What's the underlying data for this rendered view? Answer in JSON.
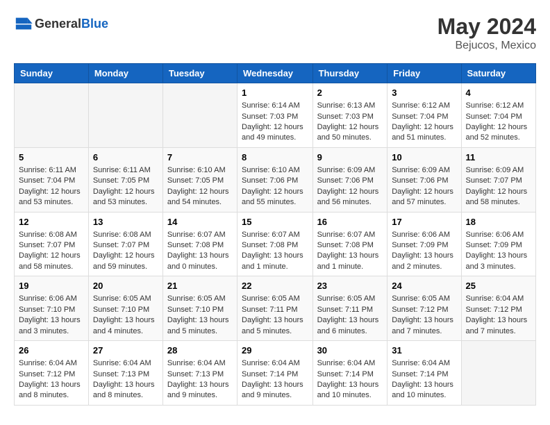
{
  "header": {
    "logo_general": "General",
    "logo_blue": "Blue",
    "month": "May 2024",
    "location": "Bejucos, Mexico"
  },
  "weekdays": [
    "Sunday",
    "Monday",
    "Tuesday",
    "Wednesday",
    "Thursday",
    "Friday",
    "Saturday"
  ],
  "weeks": [
    [
      {
        "day": "",
        "sunrise": "",
        "sunset": "",
        "daylight": ""
      },
      {
        "day": "",
        "sunrise": "",
        "sunset": "",
        "daylight": ""
      },
      {
        "day": "",
        "sunrise": "",
        "sunset": "",
        "daylight": ""
      },
      {
        "day": "1",
        "sunrise": "Sunrise: 6:14 AM",
        "sunset": "Sunset: 7:03 PM",
        "daylight": "Daylight: 12 hours and 49 minutes."
      },
      {
        "day": "2",
        "sunrise": "Sunrise: 6:13 AM",
        "sunset": "Sunset: 7:03 PM",
        "daylight": "Daylight: 12 hours and 50 minutes."
      },
      {
        "day": "3",
        "sunrise": "Sunrise: 6:12 AM",
        "sunset": "Sunset: 7:04 PM",
        "daylight": "Daylight: 12 hours and 51 minutes."
      },
      {
        "day": "4",
        "sunrise": "Sunrise: 6:12 AM",
        "sunset": "Sunset: 7:04 PM",
        "daylight": "Daylight: 12 hours and 52 minutes."
      }
    ],
    [
      {
        "day": "5",
        "sunrise": "Sunrise: 6:11 AM",
        "sunset": "Sunset: 7:04 PM",
        "daylight": "Daylight: 12 hours and 53 minutes."
      },
      {
        "day": "6",
        "sunrise": "Sunrise: 6:11 AM",
        "sunset": "Sunset: 7:05 PM",
        "daylight": "Daylight: 12 hours and 53 minutes."
      },
      {
        "day": "7",
        "sunrise": "Sunrise: 6:10 AM",
        "sunset": "Sunset: 7:05 PM",
        "daylight": "Daylight: 12 hours and 54 minutes."
      },
      {
        "day": "8",
        "sunrise": "Sunrise: 6:10 AM",
        "sunset": "Sunset: 7:06 PM",
        "daylight": "Daylight: 12 hours and 55 minutes."
      },
      {
        "day": "9",
        "sunrise": "Sunrise: 6:09 AM",
        "sunset": "Sunset: 7:06 PM",
        "daylight": "Daylight: 12 hours and 56 minutes."
      },
      {
        "day": "10",
        "sunrise": "Sunrise: 6:09 AM",
        "sunset": "Sunset: 7:06 PM",
        "daylight": "Daylight: 12 hours and 57 minutes."
      },
      {
        "day": "11",
        "sunrise": "Sunrise: 6:09 AM",
        "sunset": "Sunset: 7:07 PM",
        "daylight": "Daylight: 12 hours and 58 minutes."
      }
    ],
    [
      {
        "day": "12",
        "sunrise": "Sunrise: 6:08 AM",
        "sunset": "Sunset: 7:07 PM",
        "daylight": "Daylight: 12 hours and 58 minutes."
      },
      {
        "day": "13",
        "sunrise": "Sunrise: 6:08 AM",
        "sunset": "Sunset: 7:07 PM",
        "daylight": "Daylight: 12 hours and 59 minutes."
      },
      {
        "day": "14",
        "sunrise": "Sunrise: 6:07 AM",
        "sunset": "Sunset: 7:08 PM",
        "daylight": "Daylight: 13 hours and 0 minutes."
      },
      {
        "day": "15",
        "sunrise": "Sunrise: 6:07 AM",
        "sunset": "Sunset: 7:08 PM",
        "daylight": "Daylight: 13 hours and 1 minute."
      },
      {
        "day": "16",
        "sunrise": "Sunrise: 6:07 AM",
        "sunset": "Sunset: 7:08 PM",
        "daylight": "Daylight: 13 hours and 1 minute."
      },
      {
        "day": "17",
        "sunrise": "Sunrise: 6:06 AM",
        "sunset": "Sunset: 7:09 PM",
        "daylight": "Daylight: 13 hours and 2 minutes."
      },
      {
        "day": "18",
        "sunrise": "Sunrise: 6:06 AM",
        "sunset": "Sunset: 7:09 PM",
        "daylight": "Daylight: 13 hours and 3 minutes."
      }
    ],
    [
      {
        "day": "19",
        "sunrise": "Sunrise: 6:06 AM",
        "sunset": "Sunset: 7:10 PM",
        "daylight": "Daylight: 13 hours and 3 minutes."
      },
      {
        "day": "20",
        "sunrise": "Sunrise: 6:05 AM",
        "sunset": "Sunset: 7:10 PM",
        "daylight": "Daylight: 13 hours and 4 minutes."
      },
      {
        "day": "21",
        "sunrise": "Sunrise: 6:05 AM",
        "sunset": "Sunset: 7:10 PM",
        "daylight": "Daylight: 13 hours and 5 minutes."
      },
      {
        "day": "22",
        "sunrise": "Sunrise: 6:05 AM",
        "sunset": "Sunset: 7:11 PM",
        "daylight": "Daylight: 13 hours and 5 minutes."
      },
      {
        "day": "23",
        "sunrise": "Sunrise: 6:05 AM",
        "sunset": "Sunset: 7:11 PM",
        "daylight": "Daylight: 13 hours and 6 minutes."
      },
      {
        "day": "24",
        "sunrise": "Sunrise: 6:05 AM",
        "sunset": "Sunset: 7:12 PM",
        "daylight": "Daylight: 13 hours and 7 minutes."
      },
      {
        "day": "25",
        "sunrise": "Sunrise: 6:04 AM",
        "sunset": "Sunset: 7:12 PM",
        "daylight": "Daylight: 13 hours and 7 minutes."
      }
    ],
    [
      {
        "day": "26",
        "sunrise": "Sunrise: 6:04 AM",
        "sunset": "Sunset: 7:12 PM",
        "daylight": "Daylight: 13 hours and 8 minutes."
      },
      {
        "day": "27",
        "sunrise": "Sunrise: 6:04 AM",
        "sunset": "Sunset: 7:13 PM",
        "daylight": "Daylight: 13 hours and 8 minutes."
      },
      {
        "day": "28",
        "sunrise": "Sunrise: 6:04 AM",
        "sunset": "Sunset: 7:13 PM",
        "daylight": "Daylight: 13 hours and 9 minutes."
      },
      {
        "day": "29",
        "sunrise": "Sunrise: 6:04 AM",
        "sunset": "Sunset: 7:14 PM",
        "daylight": "Daylight: 13 hours and 9 minutes."
      },
      {
        "day": "30",
        "sunrise": "Sunrise: 6:04 AM",
        "sunset": "Sunset: 7:14 PM",
        "daylight": "Daylight: 13 hours and 10 minutes."
      },
      {
        "day": "31",
        "sunrise": "Sunrise: 6:04 AM",
        "sunset": "Sunset: 7:14 PM",
        "daylight": "Daylight: 13 hours and 10 minutes."
      },
      {
        "day": "",
        "sunrise": "",
        "sunset": "",
        "daylight": ""
      }
    ]
  ]
}
